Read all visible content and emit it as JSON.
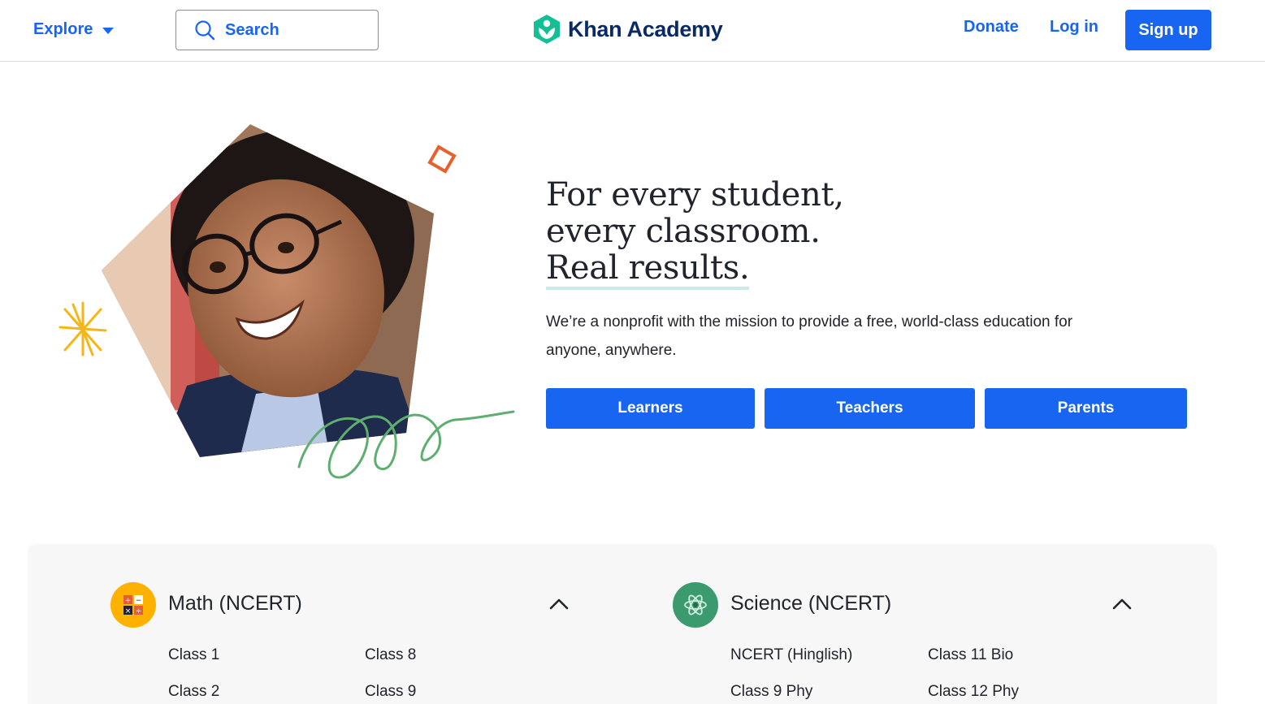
{
  "header": {
    "explore_label": "Explore",
    "search_label": "Search",
    "logo_text": "Khan Academy",
    "donate_label": "Donate",
    "login_label": "Log in",
    "signup_label": "Sign up"
  },
  "hero": {
    "headline_line1": "For every student,",
    "headline_line2": "every classroom.",
    "headline_line3": "Real results.",
    "mission": "We’re a nonprofit with the mission to provide a free, world-class education for anyone, anywhere.",
    "buttons": [
      "Learners",
      "Teachers",
      "Parents"
    ]
  },
  "subjects": [
    {
      "title": "Math (NCERT)",
      "icon": "calculator-icon",
      "expanded": true,
      "courses": [
        "Class 1",
        "Class 8",
        "Class 2",
        "Class 9"
      ]
    },
    {
      "title": "Science (NCERT)",
      "icon": "atom-icon",
      "expanded": true,
      "courses": [
        "NCERT (Hinglish)",
        "Class 11 Bio",
        "Class 9 Phy",
        "Class 12 Phy"
      ]
    }
  ],
  "colors": {
    "brand_blue": "#1865f2",
    "logo_green": "#14bf96",
    "math_yellow": "#ffb100",
    "science_green": "#3b9b6e"
  }
}
